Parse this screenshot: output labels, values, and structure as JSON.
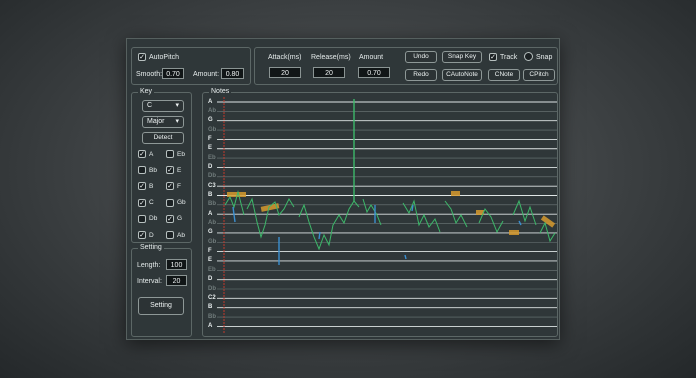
{
  "autopitch": {
    "checked": true,
    "label": "AutoPitch",
    "smooth_label": "Smooth:",
    "smooth_value": "0.70",
    "amount_label": "Amount:",
    "amount_value": "0.80"
  },
  "params": {
    "attack_label": "Attack(ms)",
    "attack_value": "20",
    "release_label": "Release(ms)",
    "release_value": "20",
    "amount_label": "Amount",
    "amount_value": "0.70"
  },
  "toolbar": {
    "undo": "Undo",
    "snap_key": "Snap Key",
    "track_label": "Track",
    "track_checked": true,
    "snap_label": "Snap",
    "redo": "Redo",
    "cautonote": "CAutoNote",
    "cnote": "CNote",
    "cpitch": "CPitch"
  },
  "key": {
    "title": "Key",
    "root": "C",
    "scale": "Major",
    "detect": "Detect",
    "notes": [
      {
        "name": "A",
        "checked": true
      },
      {
        "name": "Eb",
        "checked": false
      },
      {
        "name": "Bb",
        "checked": false
      },
      {
        "name": "E",
        "checked": true
      },
      {
        "name": "B",
        "checked": true
      },
      {
        "name": "F",
        "checked": true
      },
      {
        "name": "C",
        "checked": true
      },
      {
        "name": "Gb",
        "checked": false
      },
      {
        "name": "Db",
        "checked": false
      },
      {
        "name": "G",
        "checked": true
      },
      {
        "name": "D",
        "checked": true
      },
      {
        "name": "Ab",
        "checked": false
      }
    ]
  },
  "setting": {
    "title": "Setting",
    "length_label": "Length:",
    "length_value": "100",
    "interval_label": "Interval:",
    "interval_value": "20",
    "button": "Setting"
  },
  "notes_panel": {
    "title": "Notes",
    "rows": [
      {
        "name": "A",
        "bright": true
      },
      {
        "name": "Ab",
        "bright": false
      },
      {
        "name": "G",
        "bright": true
      },
      {
        "name": "Gb",
        "bright": false
      },
      {
        "name": "F",
        "bright": true
      },
      {
        "name": "E",
        "bright": true
      },
      {
        "name": "Eb",
        "bright": false
      },
      {
        "name": "D",
        "bright": true
      },
      {
        "name": "Db",
        "bright": false
      },
      {
        "name": "C3",
        "bright": true
      },
      {
        "name": "B",
        "bright": true
      },
      {
        "name": "Bb",
        "bright": false
      },
      {
        "name": "A",
        "bright": true
      },
      {
        "name": "Ab",
        "bright": false
      },
      {
        "name": "G",
        "bright": true
      },
      {
        "name": "Gb",
        "bright": false
      },
      {
        "name": "F",
        "bright": true
      },
      {
        "name": "E",
        "bright": true
      },
      {
        "name": "Eb",
        "bright": false
      },
      {
        "name": "D",
        "bright": true
      },
      {
        "name": "Db",
        "bright": false
      },
      {
        "name": "C2",
        "bright": true
      },
      {
        "name": "B",
        "bright": true
      },
      {
        "name": "Bb",
        "bright": false
      },
      {
        "name": "A",
        "bright": true
      }
    ]
  },
  "colors": {
    "window_bg": "#2f3739",
    "bright_line": "#dfe6e6",
    "dim_line": "#6f7a7a",
    "pitch_green": "#3db86a",
    "pitch_blue": "#3a8fd0",
    "note_orange": "#d69a2e",
    "playhead_red": "#c0392b"
  }
}
